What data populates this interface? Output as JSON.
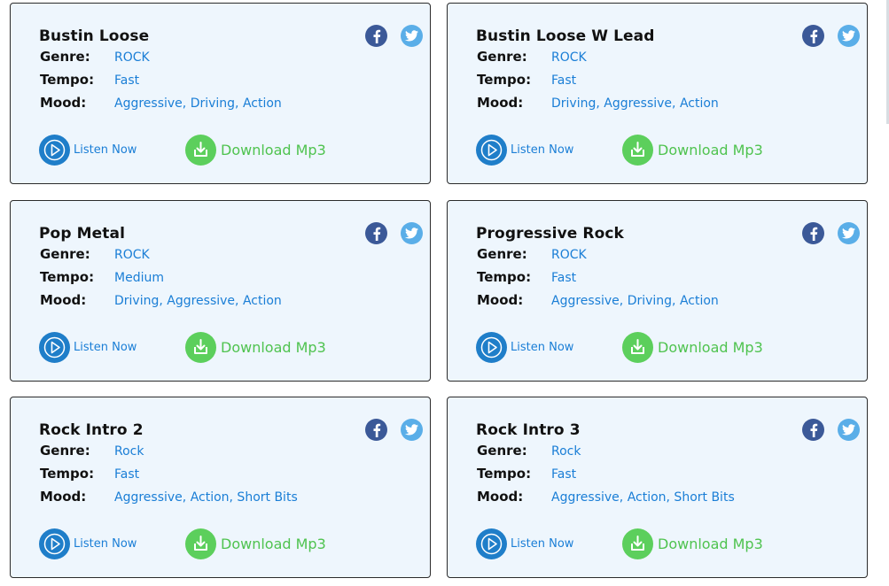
{
  "labels": {
    "genre": "Genre:",
    "tempo": "Tempo:",
    "mood": "Mood:",
    "listen": "Listen Now",
    "download": "Download Mp3"
  },
  "colors": {
    "card_bg": "#eef6fd",
    "link_blue": "#1a7ed6",
    "facebook": "#3b5998",
    "twitter": "#5aaee8",
    "play": "#1f7ec9",
    "download": "#5ccf5c"
  },
  "icons": [
    "facebook-icon",
    "twitter-icon",
    "play-icon",
    "download-icon"
  ],
  "tracks": [
    {
      "title": "Bustin Loose",
      "genre": "ROCK",
      "tempo": "Fast",
      "mood": "Aggressive, Driving, Action"
    },
    {
      "title": "Bustin Loose W Lead",
      "genre": "ROCK",
      "tempo": "Fast",
      "mood": "Driving, Aggressive, Action"
    },
    {
      "title": "Pop Metal",
      "genre": "ROCK",
      "tempo": "Medium",
      "mood": "Driving, Aggressive, Action"
    },
    {
      "title": "Progressive Rock",
      "genre": "ROCK",
      "tempo": "Fast",
      "mood": "Aggressive, Driving, Action"
    },
    {
      "title": "Rock Intro 2",
      "genre": "Rock",
      "tempo": "Fast",
      "mood": "Aggressive, Action, Short Bits"
    },
    {
      "title": "Rock Intro 3",
      "genre": "Rock",
      "tempo": "Fast",
      "mood": "Aggressive, Action, Short Bits"
    }
  ]
}
